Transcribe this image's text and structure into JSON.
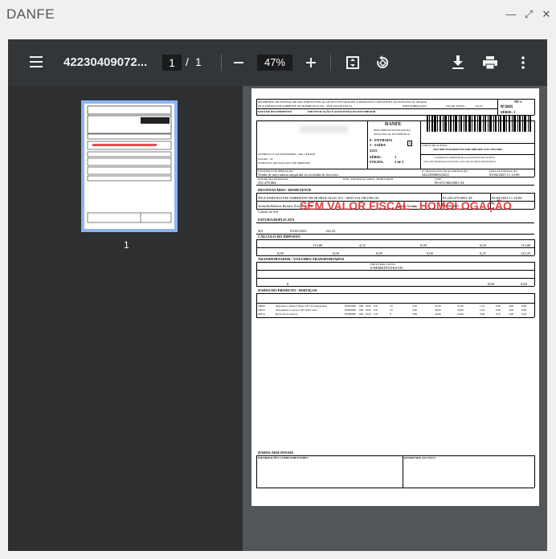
{
  "window": {
    "title": "DANFE",
    "minimize_label": "—",
    "maximize_label": "⤢",
    "close_label": "✕"
  },
  "toolbar": {
    "menu_icon": "hamburger-icon",
    "doc_title": "42230409072...",
    "current_page": "1",
    "separator": "/",
    "total_pages": "1",
    "zoom": "47%",
    "icons": [
      "zoom-out-icon",
      "zoom-in-icon",
      "fit-page-icon",
      "rotate-icon",
      "download-icon",
      "print-icon",
      "more-icon"
    ]
  },
  "sidebar": {
    "thumb_page_number": "1"
  },
  "document": {
    "watermark": "SEM VALOR FISCAL - HOMOLOGAÇÃO",
    "header_received": "RECEBEMOS DE EMISSAO DE DOCUMENTO FISCAL DE NF-E ENVIADO PELA PRODUTOS CONSTANTES NA NOTA FISCAL ABAIXO",
    "header_line2": "NF-E EMITIDA EM AMBIENTE DE HOMOLOGACAO - SEM VALOR FISCAL",
    "emissao_label": "EMISSÃO:",
    "emissao": "05/04/2023",
    "valor_total_label": "VALOR TOTAL:",
    "valor_total": "122,25",
    "nfe_label": "NF-e",
    "nfe_number": "Nº 2523",
    "serie": "SÉRIE: 1",
    "data_recebimento": "DATA DE RECEBIMENTO",
    "identificacao": "IDENTIFICAÇÃO E ASSINATURA DO RECEBEDOR",
    "danfe": "DANFE",
    "danfe_desc1": "DOCUMENTO AUXILIAR DA",
    "danfe_desc2": "NOTA FISCAL ELETRÔNICA",
    "entrada": "0 - ENTRADA",
    "saida": "1 - SAÍDA",
    "tipo": "1",
    "numero": "2523",
    "serie_big": "SÉRIE:",
    "serie_val": "1",
    "folha": "FOLHA:",
    "folha_val": "1 de 1",
    "chave_label": "CHAVE DE ACESSO",
    "chave": "4223 0409 0720 8200 0154 5500 1000 0025 2315 2194 0280",
    "consulta1": "Consulta de autenticidade no portal nacional da NF-e",
    "consulta2": "www.nfe.fazenda.gov.br/portal ou no site da Sefaz Autorizadora",
    "endereco": "AVENIDA XV DE NOVEMBRO , 466, CENTRO",
    "cidade": "Joinville - SC",
    "fone": "FONE/FAX: (49) 3522-4321 CEP: 89600-000",
    "natureza_label": "NATUREZA DE OPERAÇÃO",
    "natureza": "Venda de mercadoria adquirida ou recebida de terceiros",
    "protocolo_label": "Nº PROTOCOLO DE AUTORIZAÇÃO",
    "protocolo": "342230000343452",
    "data_aut_label": "DATA AUTORIZAÇÃO",
    "data_aut": "05/04/2023 11:14:00",
    "ie_label": "INSCRIÇÃO ESTADUAL",
    "ie": "255.478.864",
    "ie_st_label": "INSC. ESTADUAL SUBST. TRIBUTÁRIO",
    "cnpj_label": "CNPJ",
    "cnpj": "09.072.082/0001-54",
    "dest_title": "DESTINATÁRIO / REMETENTE",
    "dest_nome": "NF-E EMITIDA EM AMBIENTE DE HOMOLOGACAO - SEM VALOR FISCAL",
    "dest_cnpj": "03.245.075/0001-28",
    "dest_data": "05/04/2023 11:18:00",
    "dest_end": "Avenida Rubens Beatris Xavier, 1772",
    "dest_bairro": "Jardim Aurora",
    "dest_cep": "89056-200",
    "dest_cidade": "Caxias do Sul",
    "fatura_title": "FATURA/DUPLICATA",
    "fat_num": "001",
    "fat_venc": "03/05/2023",
    "fat_valor": "122,25",
    "calculo_title": "CÁLCULO DO IMPOSTO",
    "bc_icms": "113,00",
    "v_icms": "4,52",
    "bc_st": "0,00",
    "v_st": "0,00",
    "v_prod": "113,00",
    "v_frete": "0,00",
    "v_seguro": "0,00",
    "desconto": "0,00",
    "outras": "0,00",
    "v_ipi": "0,25",
    "v_total": "122,25",
    "transp_title": "TRANSPORTADOR / VOLUMES TRANSPORTADOS",
    "frete_label": "FRETE POR CONTA",
    "frete": "0-REMETENTE(CIF)",
    "qtd": "0",
    "peso_b": "0,00",
    "peso_l": "0,00",
    "produtos_title": "DADOS DO PRODUTO / SERVIÇOS",
    "products": [
      {
        "cod": "20008",
        "desc": "Interrutor Coluna Ultrana 1EV (Componente)",
        "ncm": "85365090",
        "cst": "000",
        "cfop": "6102",
        "un": "UN",
        "qtd": "10",
        "vunit": "3,10",
        "vtotal": "31,00",
        "bc": "31,00",
        "icms": "1,24",
        "ipi": "0,00",
        "aicms": "4,00",
        "aipi": "0,00"
      },
      {
        "cod": "20012",
        "desc": "Alojamento Conector SP 1MI 6 Vias.",
        "ncm": "85369090",
        "cst": "000",
        "cfop": "6102",
        "un": "UN",
        "qtd": "10",
        "vunit": "5,80",
        "vtotal": "58,00",
        "bc": "58,00",
        "icms": "2,32",
        "ipi": "0,00",
        "aicms": "4,00",
        "aipi": "0,00"
      },
      {
        "cod": "20014",
        "desc": "Botao Preto Pestrol.",
        "ncm": "85389090",
        "cst": "000",
        "cfop": "6102",
        "un": "UN",
        "qtd": "8",
        "vunit": "3,00",
        "vtotal": "24,00",
        "bc": "24,00",
        "icms": "0,96",
        "ipi": "0,25",
        "aicms": "4,00",
        "aipi": "0,00"
      }
    ],
    "adicionais_title": "DADOS ADICIONAIS",
    "info_compl": "INFORMAÇÕES COMPLEMENTARES",
    "reservado": "RESERVADO AO FISCO"
  }
}
